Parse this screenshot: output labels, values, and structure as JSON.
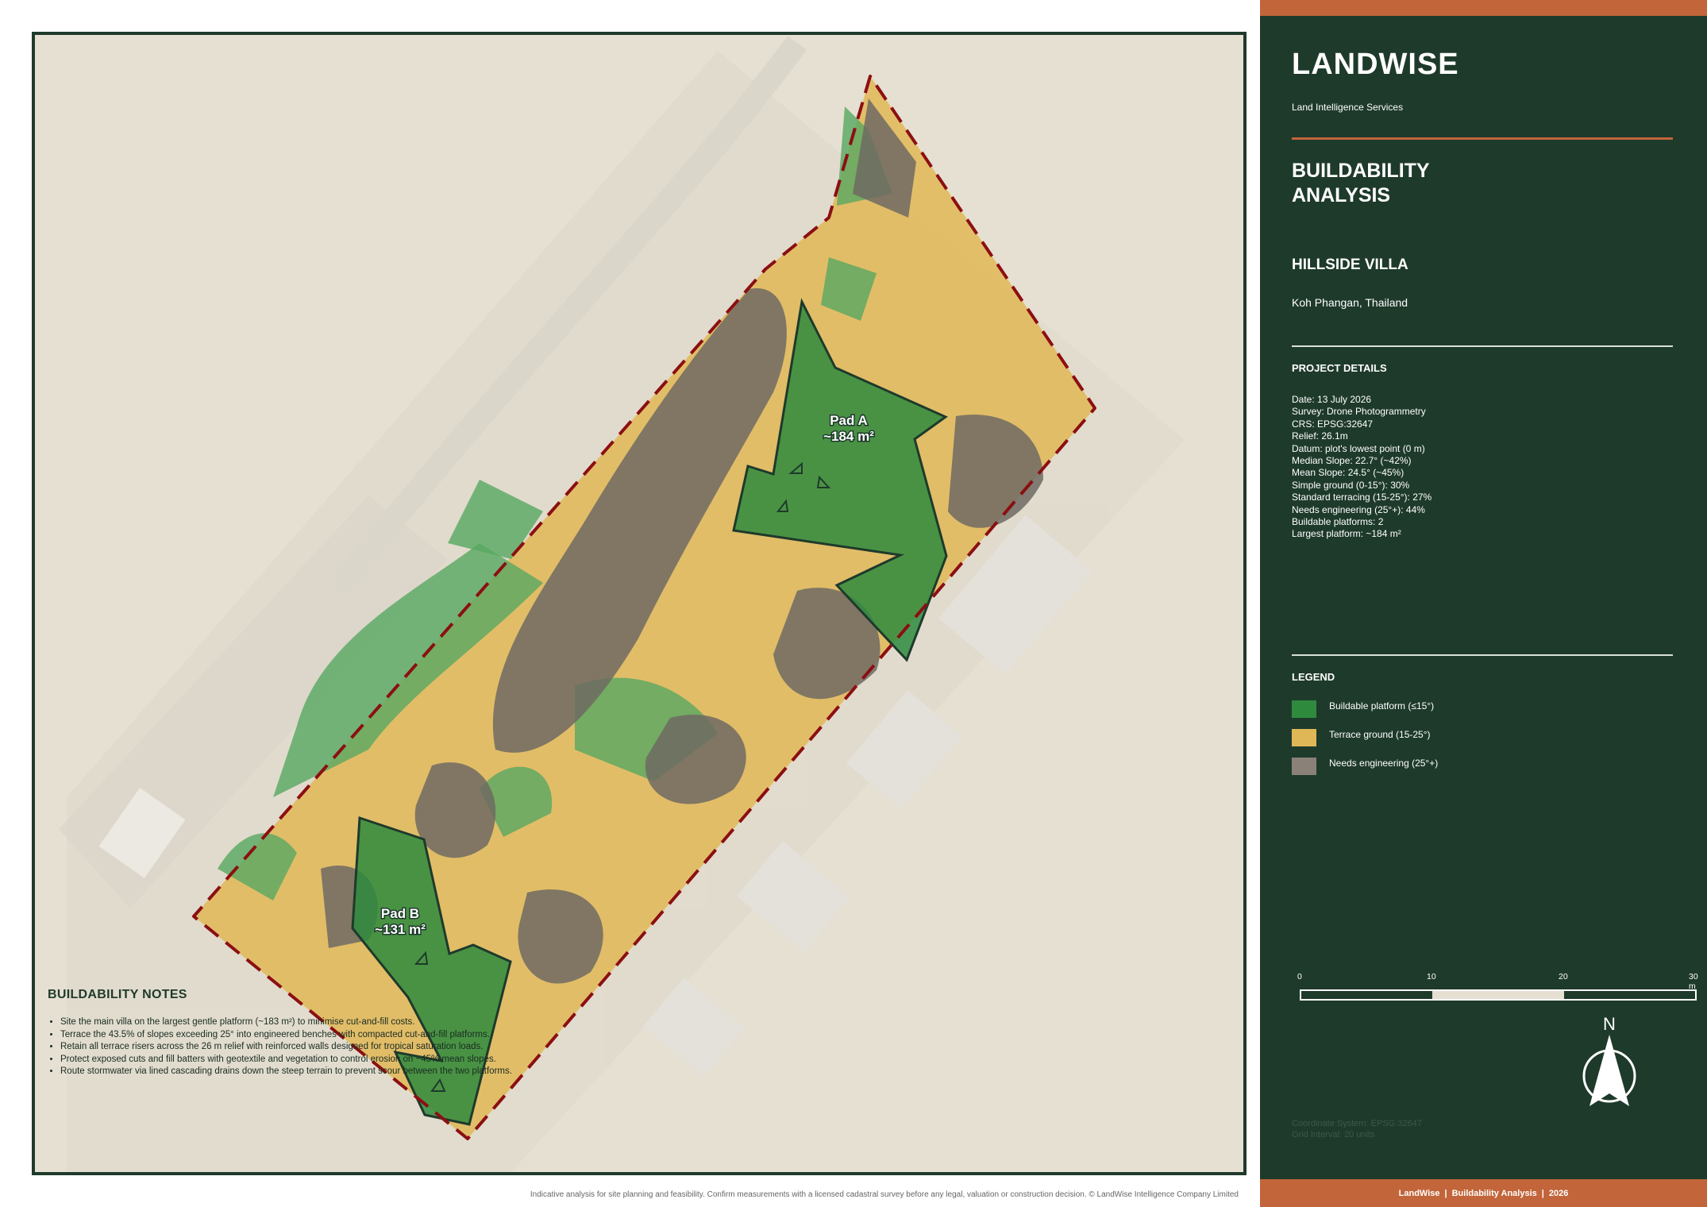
{
  "map": {
    "pads": [
      {
        "name": "Pad A",
        "area": "~184 m²"
      },
      {
        "name": "Pad B",
        "area": "~131 m²"
      }
    ],
    "colors": {
      "boundary": "#8b0f12",
      "buildable": "#2e8b3e",
      "terrace": "#e0b756",
      "engineering": "#8a8278",
      "background": "#e6e0d3"
    }
  },
  "notes": {
    "title": "BUILDABILITY NOTES",
    "items": [
      "Site the main villa on the largest gentle platform (~183 m²) to minimise cut-and-fill costs.",
      "Terrace the 43.5% of slopes exceeding 25° into engineered benches with compacted cut-and-fill platforms.",
      "Retain all terrace risers across the 26 m relief with reinforced walls designed for tropical saturation loads.",
      "Protect exposed cuts and fill batters with geotextile and vegetation to control erosion on ~45% mean slopes.",
      "Route stormwater via lined cascading drains down the steep terrain to prevent scour between the two platforms."
    ]
  },
  "footer_note": "Indicative analysis for site planning and feasibility. Confirm measurements with a licensed cadastral survey before any legal, valuation or construction decision. © LandWise Intelligence Company Limited",
  "sidebar": {
    "brand": "LANDWISE",
    "brand_sub": "Land Intelligence Services",
    "report_title": "BUILDABILITY ANALYSIS",
    "project_name": "HILLSIDE VILLA",
    "project_location": "Koh Phangan, Thailand",
    "details_heading": "PROJECT DETAILS",
    "details": [
      "Date:  13 July 2026",
      "Survey:  Drone Photogrammetry",
      "CRS:  EPSG:32647",
      "Relief:  26.1m",
      "Datum:  plot's lowest point (0 m)",
      "Median Slope:  22.7°  (~42%)",
      "Mean Slope:  24.5°  (~45%)",
      "Simple ground (0-15°):  30%",
      "Standard terracing (15-25°):  27%",
      "Needs engineering (25°+):  44%",
      "Buildable platforms:  2",
      "Largest platform:  ~184 m²"
    ],
    "legend_heading": "LEGEND",
    "legend": [
      {
        "label": "Buildable platform (≤15°)",
        "color": "#2e8b3e"
      },
      {
        "label": "Terrace ground (15-25°)",
        "color": "#e0b756"
      },
      {
        "label": "Needs engineering (25°+)",
        "color": "#8a8278"
      }
    ],
    "scale_labels": [
      "0",
      "10",
      "20",
      "30 m"
    ],
    "north_label": "N",
    "coord_meta": [
      "Coordinate System: EPSG:32647",
      "Grid Interval: 20 units"
    ],
    "footer": [
      "LandWise",
      "Buildability Analysis",
      "2026"
    ]
  }
}
